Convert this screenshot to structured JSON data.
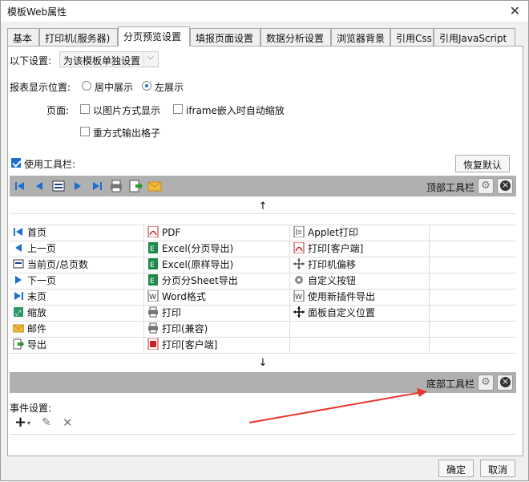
{
  "window": {
    "title": "模板Web属性"
  },
  "tabs": [
    {
      "label": "基本"
    },
    {
      "label": "打印机(服务器)"
    },
    {
      "label": "分页预览设置"
    },
    {
      "label": "填报页面设置"
    },
    {
      "label": "数据分析设置"
    },
    {
      "label": "浏览器背景"
    },
    {
      "label": "引用Css"
    },
    {
      "label": "引用JavaScript"
    }
  ],
  "settings": {
    "label": "以下设置:",
    "value": "为该模板单独设置"
  },
  "position": {
    "label": "报表显示位置:",
    "options": [
      {
        "label": "居中展示",
        "selected": false
      },
      {
        "label": "左展示",
        "selected": true
      }
    ]
  },
  "page": {
    "label": "页面:",
    "opt_image": "以图片方式显示",
    "opt_iframe": "iframe嵌入时自动缩放",
    "opt_grid": "重方式输出格子"
  },
  "toolbar": {
    "use_label": "使用工具栏:",
    "use_checked": true,
    "restore_button": "恢复默认",
    "top_label": "顶部工具栏",
    "bottom_label": "底部工具栏",
    "up_arrow": "↑",
    "down_arrow": "↓"
  },
  "buttons_grid": {
    "col1": [
      "首页",
      "上一页",
      "当前页/总页数",
      "下一页",
      "末页",
      "缩放",
      "邮件",
      "导出"
    ],
    "col2": [
      "PDF",
      "Excel(分页导出)",
      "Excel(原样导出)",
      "分页分Sheet导出",
      "Word格式",
      "打印",
      "打印(兼容)",
      "打印[客户端]"
    ],
    "col3": [
      "Applet打印",
      "打印[客户端]",
      "打印机偏移",
      "自定义按钮",
      "使用新插件导出",
      "面板自定义位置"
    ]
  },
  "events": {
    "label": "事件设置:"
  },
  "footer": {
    "ok": "确定",
    "cancel": "取消"
  },
  "colors": {
    "accent": "#1a6fd0",
    "toolbar_bg": "#b0b0b0",
    "annotation": "#e8352a"
  }
}
